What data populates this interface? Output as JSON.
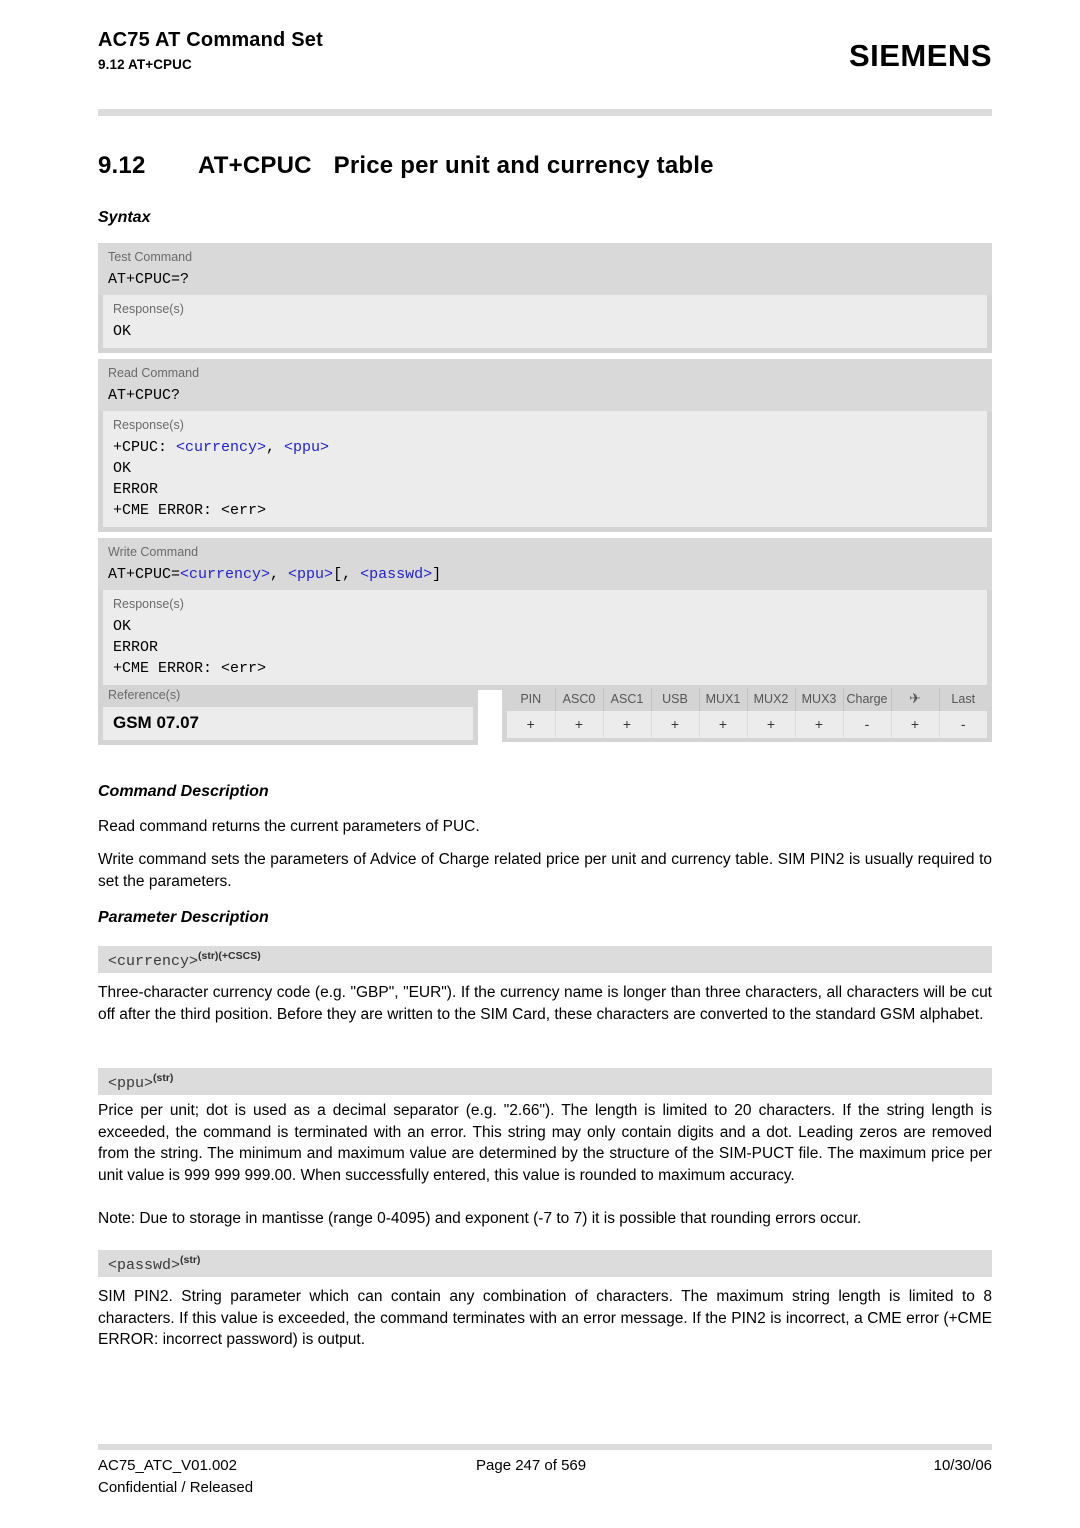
{
  "header": {
    "doc_title": "AC75 AT Command Set",
    "section_ref": "9.12 AT+CPUC",
    "brand": "SIEMENS"
  },
  "section": {
    "number": "9.12",
    "command": "AT+CPUC",
    "title": "Price per unit and currency table"
  },
  "headings": {
    "syntax": "Syntax",
    "command_description": "Command Description",
    "parameter_description": "Parameter Description"
  },
  "syntax": {
    "blocks": [
      {
        "command_label": "Test Command",
        "command": "AT+CPUC=?",
        "response_label": "Response(s)",
        "responses": [
          "OK"
        ]
      },
      {
        "command_label": "Read Command",
        "command": "AT+CPUC?",
        "response_label": "Response(s)",
        "responses": [
          "+CPUC: <currency>, <ppu>",
          "OK",
          "ERROR",
          "+CME ERROR: <err>"
        ]
      },
      {
        "command_label": "Write Command",
        "command": "AT+CPUC=<currency>, <ppu>[, <passwd>]",
        "response_label": "Response(s)",
        "responses": [
          "OK",
          "ERROR",
          "+CME ERROR: <err>"
        ]
      }
    ]
  },
  "references": {
    "label": "Reference(s)",
    "value": "GSM 07.07"
  },
  "capabilities": {
    "columns": [
      "PIN",
      "ASC0",
      "ASC1",
      "USB",
      "MUX1",
      "MUX2",
      "MUX3",
      "Charge",
      "airplane-icon",
      "Last"
    ],
    "values": [
      "+",
      "+",
      "+",
      "+",
      "+",
      "+",
      "+",
      "-",
      "+",
      "-"
    ]
  },
  "command_description": {
    "paragraphs": [
      "Read command returns the current parameters of PUC.",
      "Write command sets the parameters of Advice of Charge related price per unit and currency table. SIM PIN2 is usually required to set the parameters."
    ]
  },
  "parameters": [
    {
      "name": "<currency>",
      "superscript": "(str)(+CSCS)",
      "text": "Three-character currency code (e.g. \"GBP\", \"EUR\"). If the currency name is longer than three characters, all characters will be cut off after the third position. Before they are written to the SIM Card, these characters are converted to the standard GSM alphabet."
    },
    {
      "name": "<ppu>",
      "superscript": "(str)",
      "text": "Price per unit; dot is used as a decimal separator (e.g. \"2.66\"). The length is limited to 20 characters. If the string length is exceeded, the command is terminated with an error. This string may only contain digits and a dot. Leading zeros are removed from the string. The minimum and maximum value are determined by the structure of the SIM-PUCT file. The maximum price per unit value is 999 999 999.00. When successfully entered, this value is rounded to maximum accuracy.",
      "note": "Note: Due to storage in mantisse (range 0-4095) and exponent (-7 to 7) it is possible that rounding errors occur."
    },
    {
      "name": "<passwd>",
      "superscript": "(str)",
      "text": "SIM PIN2. String parameter which can contain any combination of characters. The maximum string length is limited to 8 characters. If this value is exceeded, the command terminates with an error message. If the PIN2 is incorrect, a CME error (+CME ERROR: incorrect password) is output."
    }
  ],
  "footer": {
    "doc_id": "AC75_ATC_V01.002",
    "page": "Page 247 of 569",
    "date": "10/30/06",
    "classification": "Confidential / Released"
  }
}
